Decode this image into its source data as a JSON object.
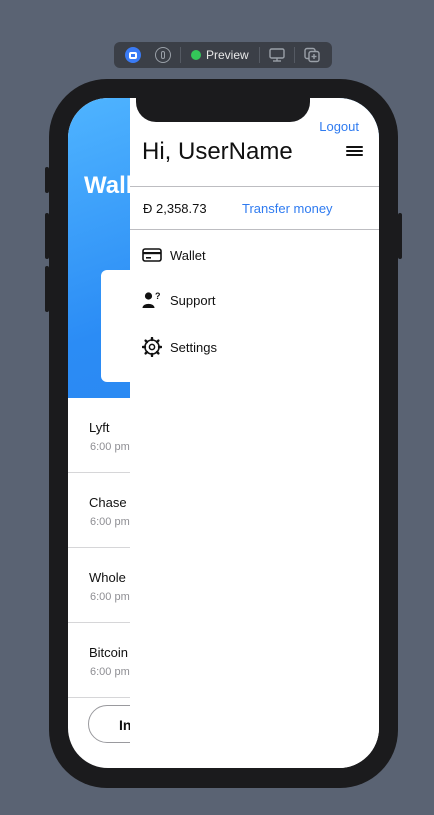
{
  "toolbar": {
    "preview_label": "Preview",
    "icons": [
      "live-preview-icon",
      "inspect-icon",
      "device-icon",
      "duplicate-icon"
    ]
  },
  "wallet": {
    "title": "Wall",
    "transactions": [
      {
        "name": "Lyft",
        "time": "6:00 pm"
      },
      {
        "name": "Chase I",
        "time": "6:00 pm"
      },
      {
        "name": "Whole I",
        "time": "6:00 pm"
      },
      {
        "name": "Bitcoin",
        "time": "6:00 pm"
      }
    ],
    "bottom_button": "Inv"
  },
  "menu": {
    "logout": "Logout",
    "greeting": "Hi, UserName",
    "balance": "Đ 2,358.73",
    "transfer": "Transfer money",
    "items": [
      {
        "label": "Wallet",
        "icon": "creditcard-icon"
      },
      {
        "label": "Support",
        "icon": "person-question-icon"
      },
      {
        "label": "Settings",
        "icon": "gear-icon"
      }
    ]
  },
  "colors": {
    "accent": "#2f7bf0",
    "header_gradient_start": "#4fb4ff",
    "header_gradient_end": "#2a86f0",
    "preview_dot": "#34c759"
  }
}
